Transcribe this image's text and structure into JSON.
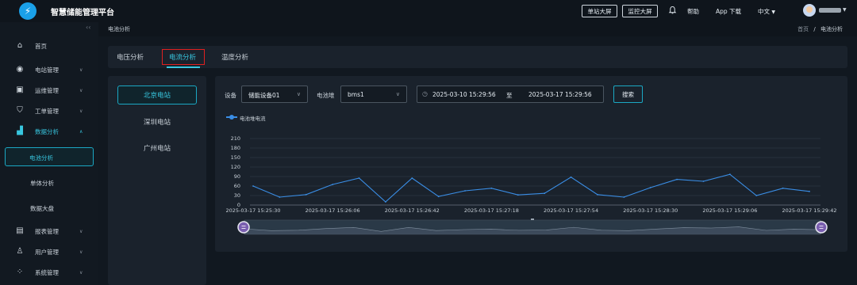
{
  "header": {
    "app_title": "智慧储能管理平台",
    "logo_icon": "lightning-icon",
    "btn_single_screen": "单站大屏",
    "btn_monitor_screen": "监控大屏",
    "help": "帮助",
    "app_download": "App 下载",
    "language": "中文"
  },
  "sidebar": {
    "items": [
      {
        "label": "首页",
        "icon": "home-icon"
      },
      {
        "label": "电站管理",
        "icon": "station-icon"
      },
      {
        "label": "运维管理",
        "icon": "maintenance-icon"
      },
      {
        "label": "工单管理",
        "icon": "workorder-icon"
      },
      {
        "label": "数据分析",
        "icon": "chart-icon"
      },
      {
        "label": "报表管理",
        "icon": "report-icon"
      },
      {
        "label": "用户管理",
        "icon": "user-icon"
      },
      {
        "label": "系统管理",
        "icon": "system-icon"
      }
    ],
    "sub_items": [
      "电池分析",
      "单体分析",
      "数据大盘"
    ]
  },
  "breadcrumb": {
    "current": "电池分析",
    "home": "首页",
    "sep": "/"
  },
  "tabs": [
    "电压分析",
    "电流分析",
    "温度分析"
  ],
  "stations": [
    "北京电站",
    "深圳电站",
    "广州电站"
  ],
  "filters": {
    "device_label": "设备",
    "device_value": "储能设备01",
    "stack_label": "电池堆",
    "stack_value": "bms1",
    "start": "2025-03-10 15:29:56",
    "to": "至",
    "end": "2025-03-17 15:29:56",
    "search": "搜索"
  },
  "colors": {
    "accent": "#38c7e0",
    "line": "#3a8ee6",
    "highlight": "#e02020"
  },
  "chart_data": {
    "type": "line",
    "series": [
      {
        "name": "电池堆电流",
        "values": [
          60,
          25,
          33,
          65,
          85,
          10,
          85,
          27,
          45,
          53,
          32,
          37,
          88,
          33,
          25,
          55,
          81,
          75,
          97,
          30,
          53,
          43
        ]
      }
    ],
    "x": [
      "2025-03-17 15:25:30",
      "",
      "",
      "2025-03-17 15:26:06",
      "",
      "",
      "2025-03-17 15:26:42",
      "",
      "",
      "2025-03-17 15:27:18",
      "",
      "",
      "2025-03-17 15:27:54",
      "",
      "",
      "2025-03-17 15:28:30",
      "",
      "",
      "2025-03-17 15:29:06",
      "",
      "",
      "2025-03-17 15:29:42"
    ],
    "yticks": [
      0,
      30,
      60,
      90,
      120,
      150,
      180,
      210
    ],
    "ylim": [
      0,
      210
    ],
    "legend": "top-left",
    "grid": true,
    "datazoom": true
  }
}
